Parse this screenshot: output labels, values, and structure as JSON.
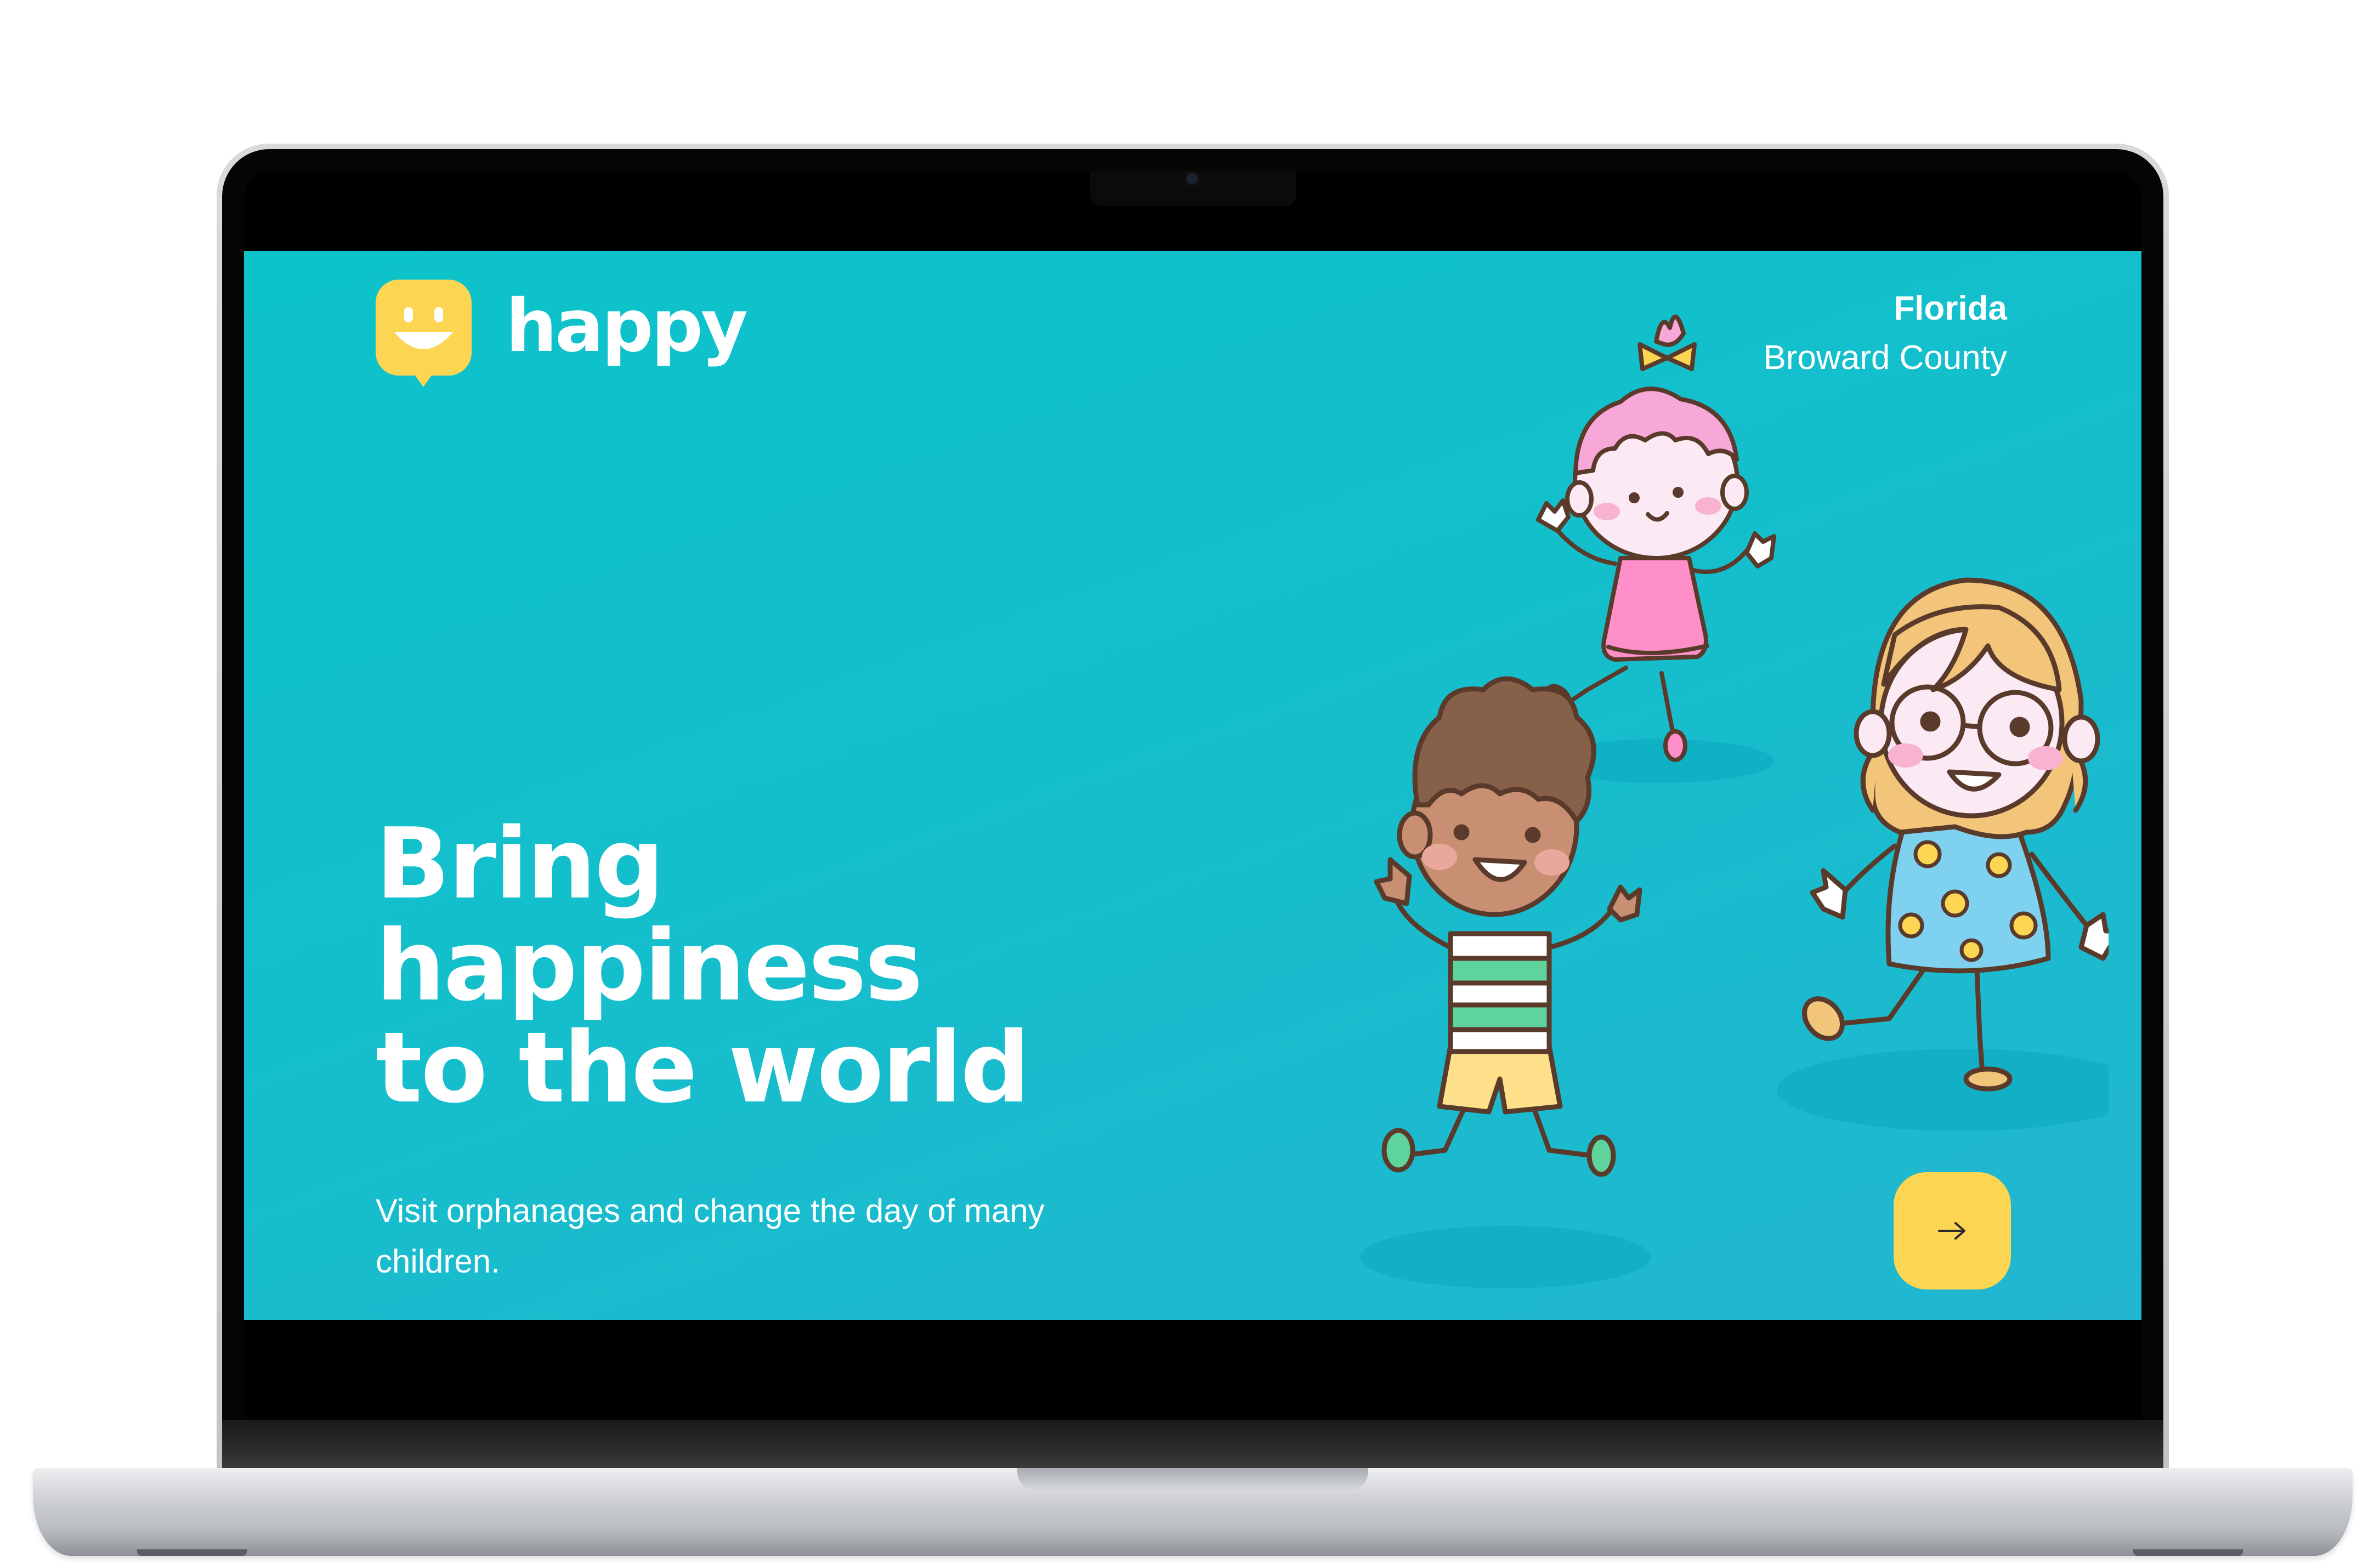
{
  "app": {
    "logo_text": "happy",
    "logo_icon": "smiley-speech-bubble-icon"
  },
  "location": {
    "state": "Florida",
    "county": "Broward County"
  },
  "hero": {
    "title_lines": [
      "Bring",
      "happiness",
      "to the world"
    ],
    "subtitle": "Visit orphanages and change the day of many children."
  },
  "cta": {
    "icon": "arrow-right-icon"
  },
  "illustration": {
    "description_icon": "three-kids-illustration"
  },
  "colors": {
    "screen_bg_start": "#0cc2c9",
    "screen_bg_end": "#22b6d0",
    "logo_yellow": "#fcd553",
    "cta_yellow": "#fcd553",
    "text": "#ffffff"
  }
}
